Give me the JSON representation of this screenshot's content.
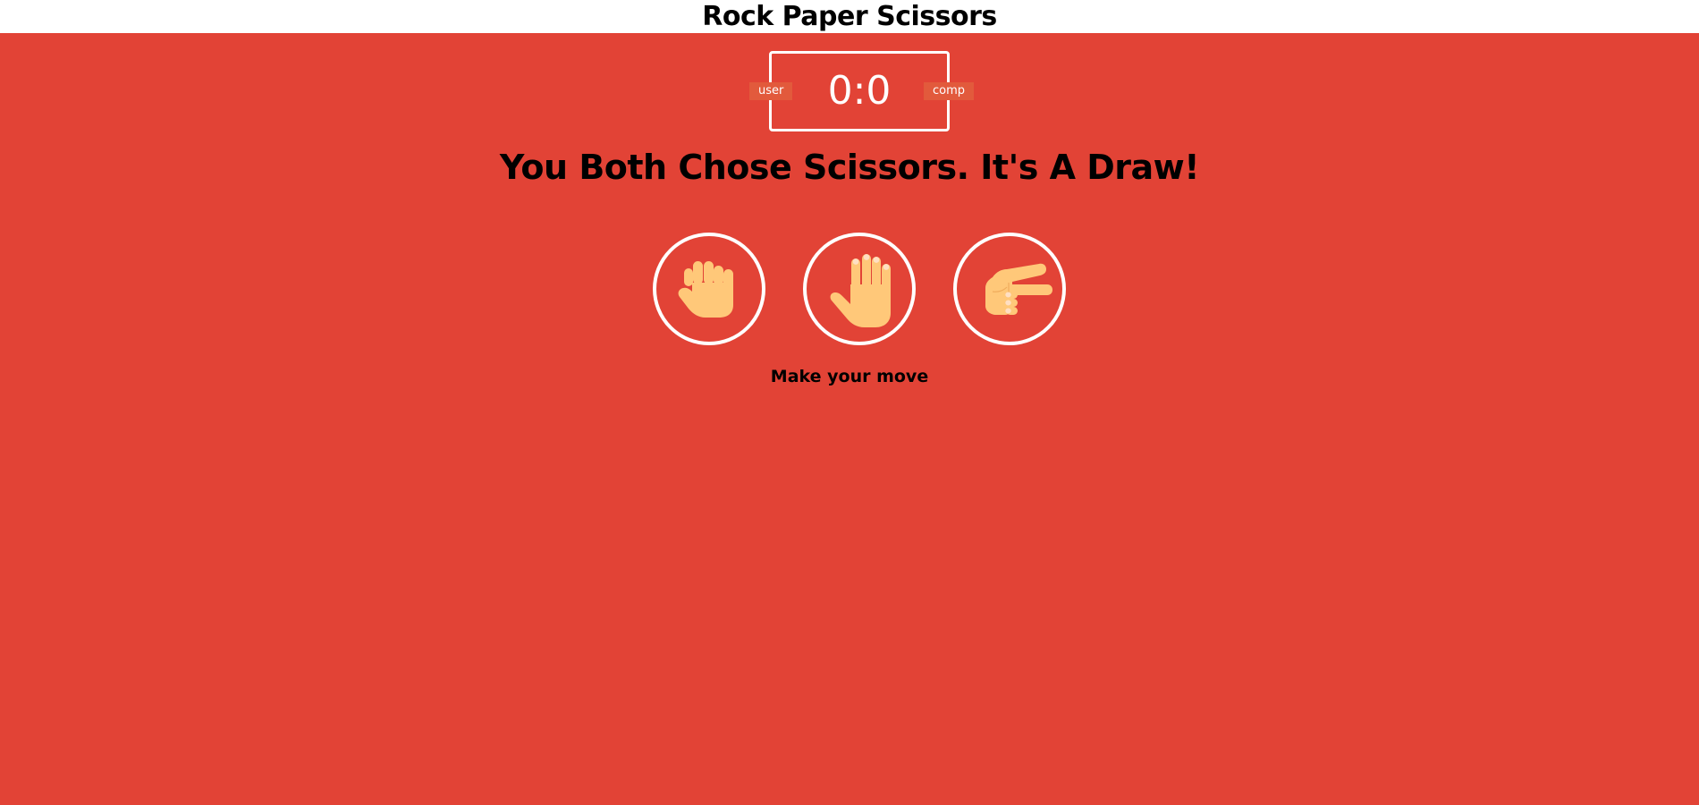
{
  "header": {
    "title": "Rock Paper Scissors"
  },
  "scoreboard": {
    "user_label": "user",
    "comp_label": "comp",
    "score_text": "0:0"
  },
  "result": {
    "message": "You Both Chose Scissors. It's A Draw!"
  },
  "choices": [
    {
      "name": "rock",
      "icon": "rock-hand-icon"
    },
    {
      "name": "paper",
      "icon": "paper-hand-icon"
    },
    {
      "name": "scissors",
      "icon": "scissors-hand-icon"
    }
  ],
  "action": {
    "message": "Make your move"
  },
  "colors": {
    "background": "#e24336",
    "badge": "#e25a3c",
    "ring": "#ffffff",
    "hand": "#ffc879",
    "nail": "#ffdfc3"
  }
}
